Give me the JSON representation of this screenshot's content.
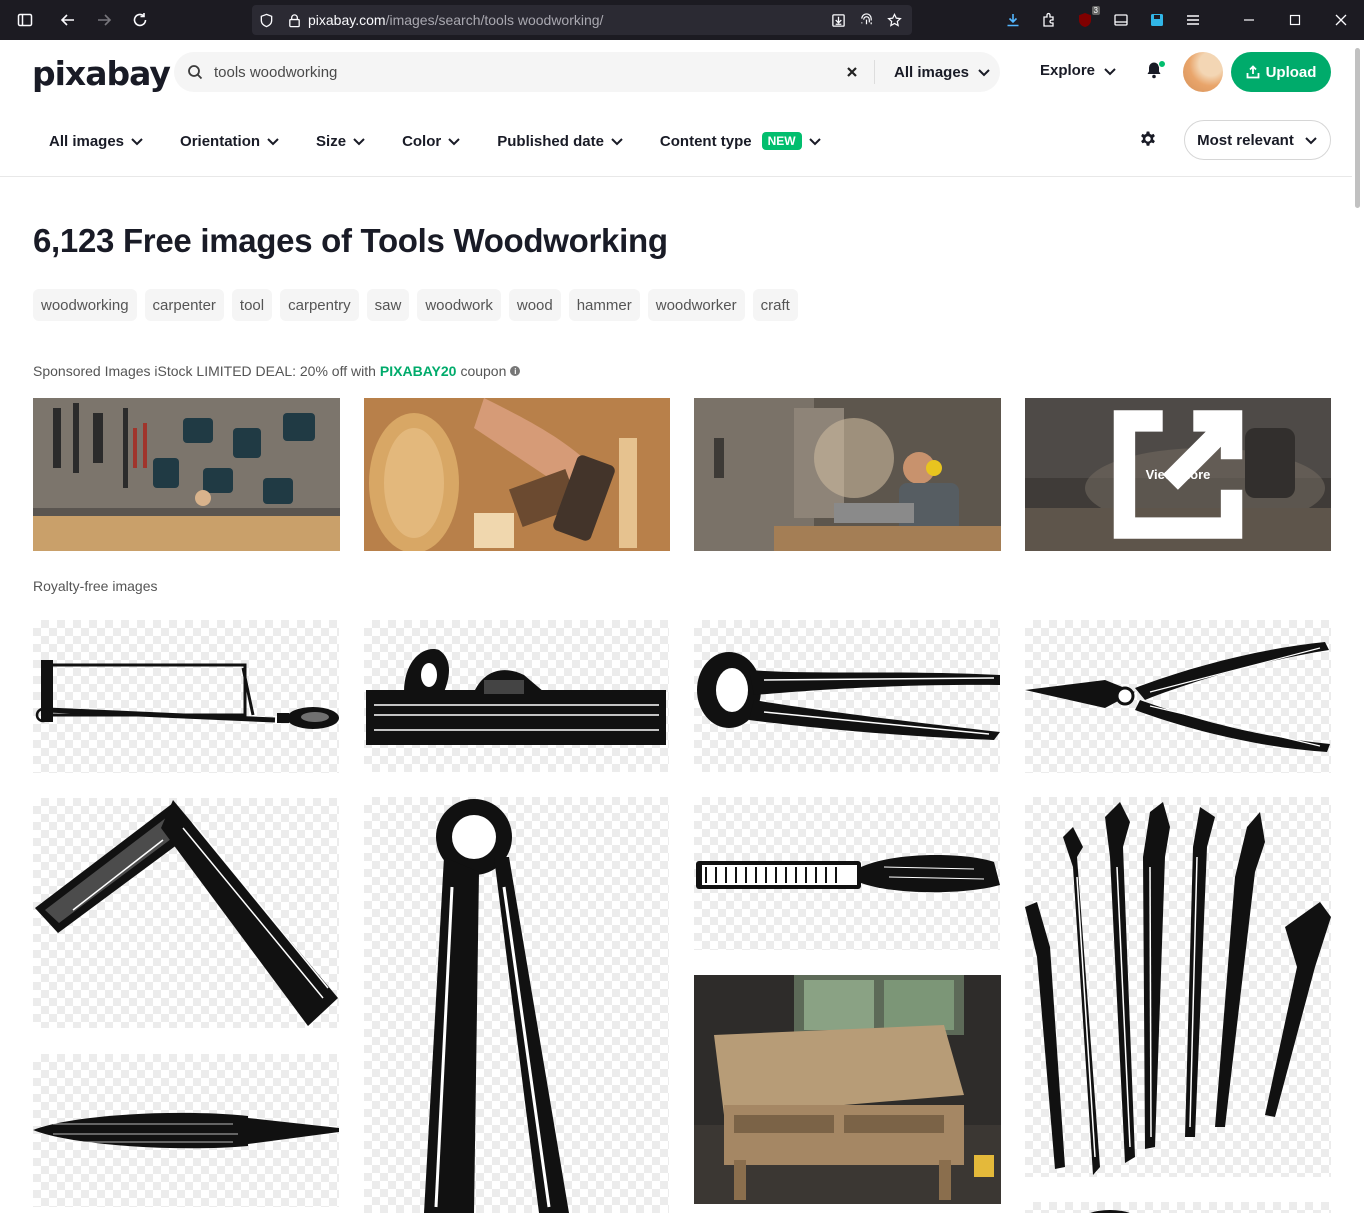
{
  "browser": {
    "url_domain": "pixabay.com",
    "url_path": "/images/search/tools woodworking/",
    "extension_badge": "3"
  },
  "nav": {
    "logo": "pixabay",
    "search_value": "tools woodworking",
    "search_scope": "All images",
    "explore": "Explore",
    "upload": "Upload"
  },
  "filters": {
    "items": [
      "All images",
      "Orientation",
      "Size",
      "Color",
      "Published date",
      "Content type"
    ],
    "new_badge": "NEW",
    "sort": "Most relevant"
  },
  "main": {
    "heading": "6,123 Free images of Tools Woodworking",
    "tags": [
      "woodworking",
      "carpenter",
      "tool",
      "carpentry",
      "saw",
      "woodwork",
      "wood",
      "hammer",
      "woodworker",
      "craft"
    ],
    "sponsored_text": "Sponsored Images iStock LIMITED DEAL: 20% off with",
    "sponsored_code": "PIXABAY20",
    "sponsored_suffix": "coupon",
    "view_more": "View more",
    "royalty_label": "Royalty-free images"
  }
}
